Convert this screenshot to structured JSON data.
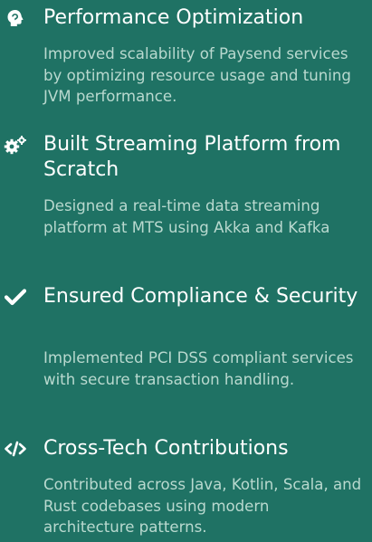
{
  "items": [
    {
      "icon": "brain-icon",
      "title": "Performance Optimization",
      "description": "Improved scalability of Paysend services by optimizing resource usage and tuning JVM performance."
    },
    {
      "icon": "gears-icon",
      "title": "Built Streaming Platform from Scratch",
      "description": "Designed a real-time data streaming platform at MTS using Akka and Kafka"
    },
    {
      "icon": "check-icon",
      "title": "Ensured Compliance & Security",
      "description": "Implemented PCI DSS compliant services with secure transaction handling."
    },
    {
      "icon": "code-icon",
      "title": "Cross-Tech Contributions",
      "description": "Contributed across Java, Kotlin, Scala, and Rust codebases using modern architecture patterns."
    }
  ],
  "colors": {
    "background": "#1f7264",
    "title": "#ffffff",
    "description": "#b9d9cf"
  }
}
